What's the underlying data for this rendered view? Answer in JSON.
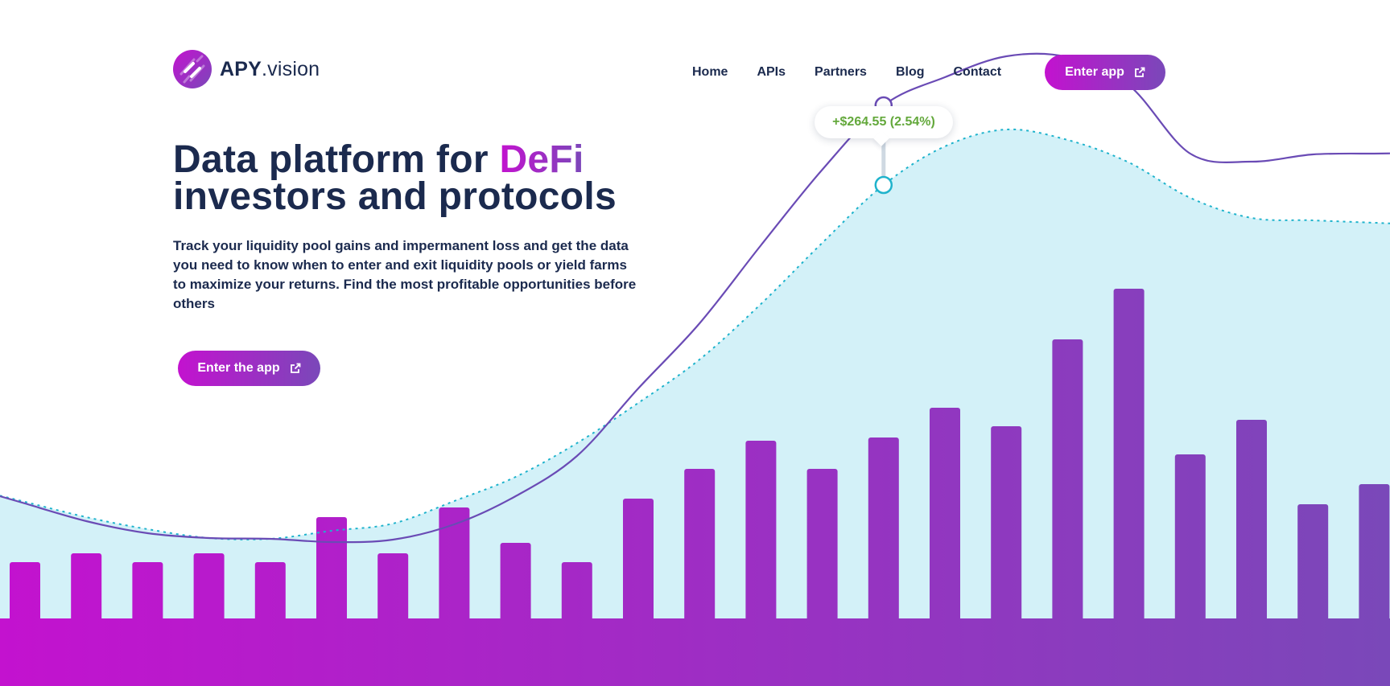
{
  "brand": {
    "name_bold": "APY",
    "name_rest": ".vision",
    "logo_colors": [
      "#c312cf",
      "#7a48b9"
    ]
  },
  "nav": {
    "links": [
      "Home",
      "APIs",
      "Partners",
      "Blog",
      "Contact"
    ],
    "cta_label": "Enter app",
    "cta_icon": "external-link-icon"
  },
  "hero": {
    "title_line1_prefix": "Data platform for ",
    "title_highlight": "DeFi",
    "title_line2": "investors and protocols",
    "description": "Track your liquidity pool gains and impermanent loss and get the data you need to know when to enter and exit liquidity pools or yield farms to maximize your returns. Find the most profitable opportunities before others",
    "cta_label": "Enter the app",
    "cta_icon": "external-link-icon"
  },
  "tooltip": {
    "text": "+$264.55 (2.54%)",
    "color": "#63a83b"
  },
  "colors": {
    "text": "#1b2a4e",
    "accent_start": "#c312cf",
    "accent_end": "#7a48b9",
    "area_fill": "#d3f1f8",
    "dotted_line": "#1fb3cc",
    "solid_line": "#6a4bb5",
    "tooltip_green": "#63a83b"
  },
  "chart_data": {
    "type": "bar",
    "bar_values": [
      70,
      81,
      70,
      81,
      70,
      126,
      81,
      138,
      94,
      70,
      149,
      186,
      221,
      186,
      225,
      262,
      239,
      347,
      410,
      204,
      247,
      142,
      167
    ],
    "solid_line_values": [
      143,
      121,
      106,
      100,
      99,
      95,
      98,
      117,
      152,
      202,
      286,
      367,
      464,
      558,
      638,
      673,
      699,
      698,
      663,
      578,
      568,
      577,
      578
    ],
    "dotted_line_values": [
      145,
      126,
      111,
      100,
      99,
      109,
      118,
      146,
      176,
      218,
      268,
      322,
      391,
      467,
      539,
      587,
      608,
      595,
      567,
      523,
      498,
      495,
      492
    ],
    "highlight_index": 14
  }
}
